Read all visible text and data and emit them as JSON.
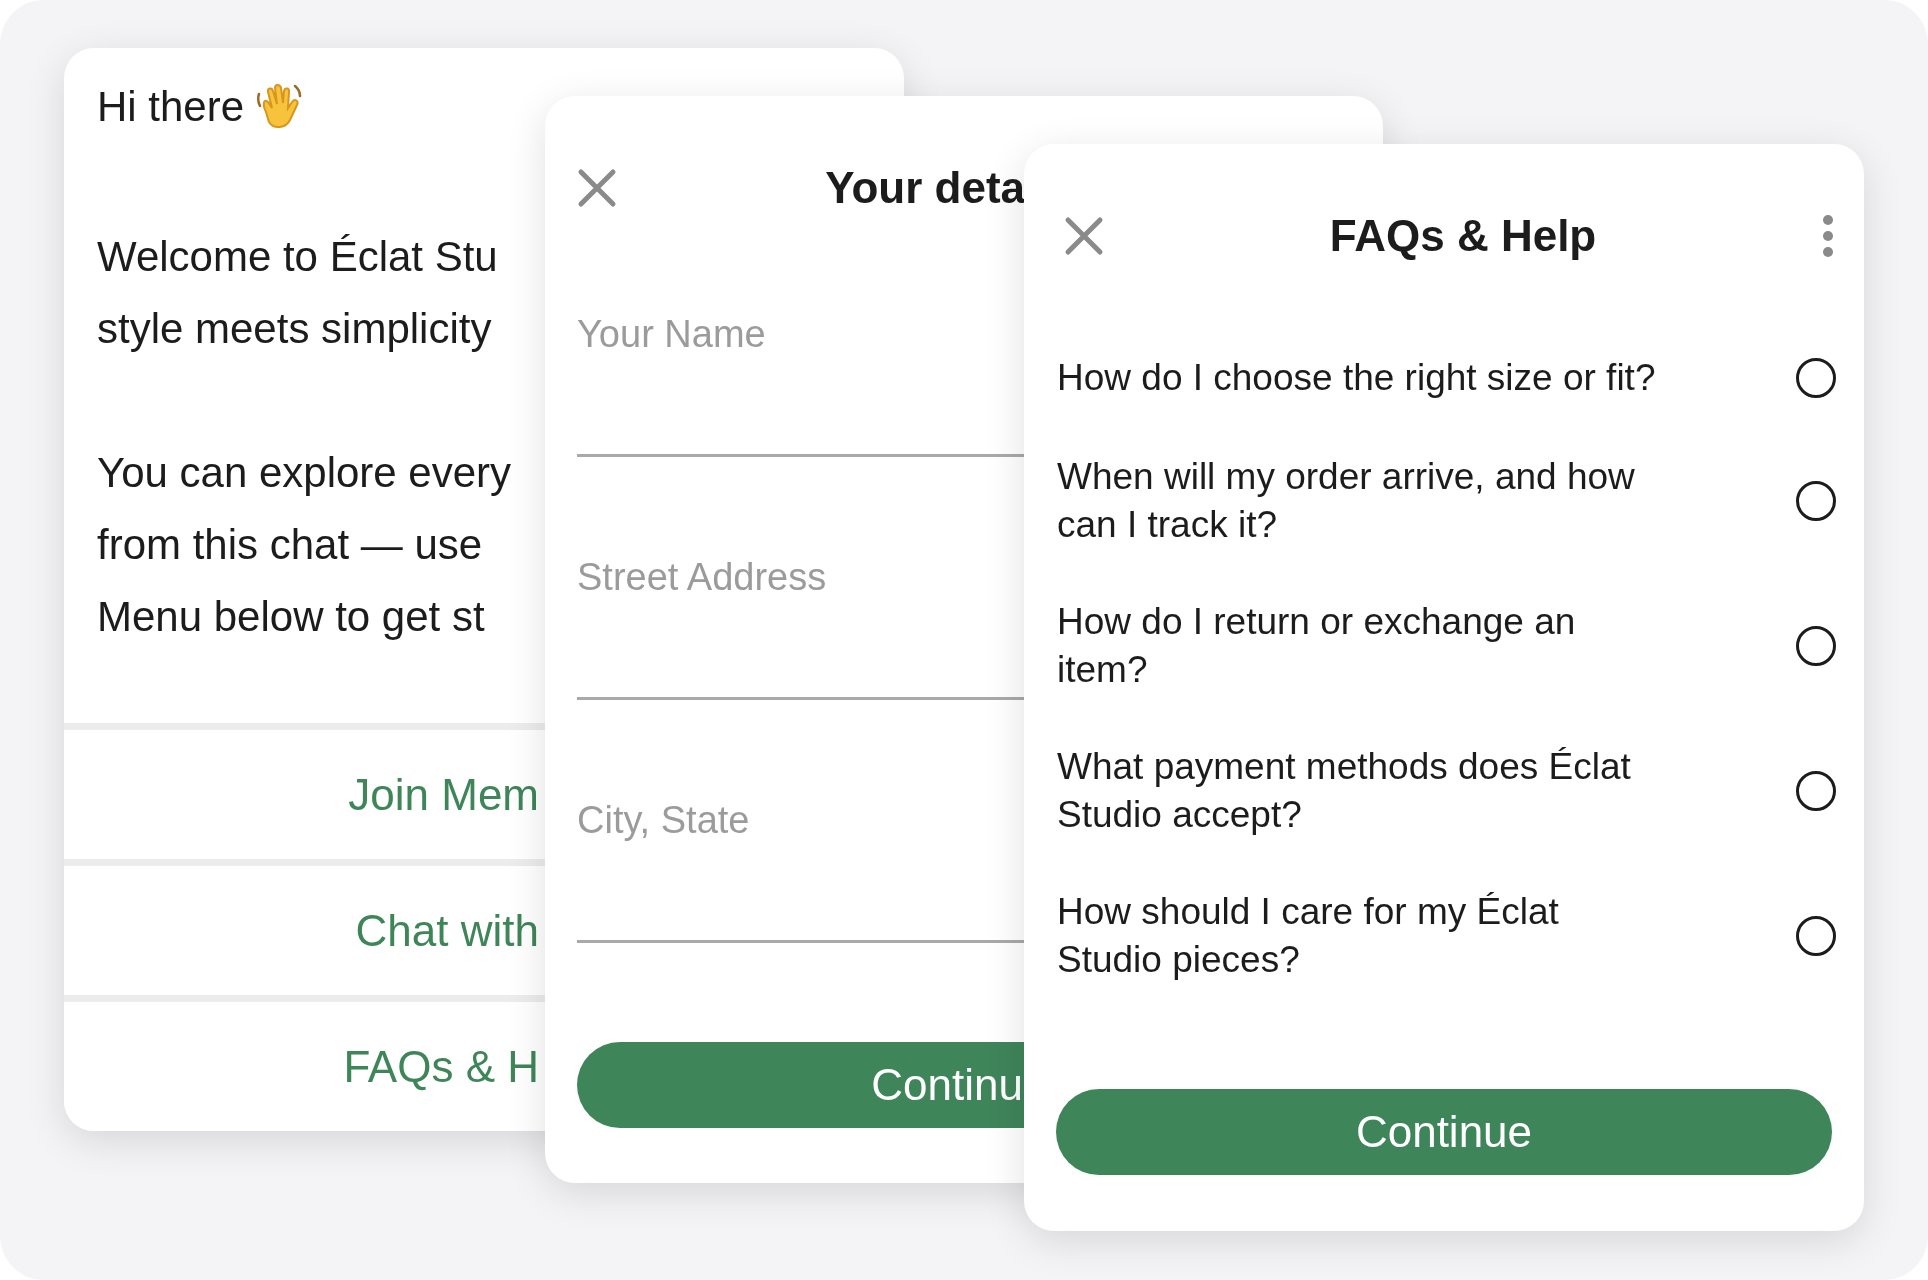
{
  "welcome_card": {
    "greeting": "Hi there",
    "paragraphs": [
      [
        "Welcome to Éclat Stu",
        "style meets simplicity"
      ],
      [
        "You can explore every",
        "from this chat — use",
        "Menu below to get st"
      ]
    ],
    "buttons": [
      "Join Mem",
      "Chat with",
      "FAQs & H"
    ]
  },
  "details_card": {
    "title": "Your deta",
    "fields": [
      {
        "placeholder": "Your Name"
      },
      {
        "placeholder": "Street Address"
      },
      {
        "placeholder": "City, State"
      }
    ],
    "button": "Continu"
  },
  "faq_card": {
    "title": "FAQs & Help",
    "questions": [
      {
        "lines": [
          "How do I choose the right size or fit?"
        ],
        "selected": false
      },
      {
        "lines": [
          "When will my order arrive, and how",
          "can I track it?"
        ],
        "selected": false
      },
      {
        "lines": [
          "How do I return or exchange an",
          "item?"
        ],
        "selected": false
      },
      {
        "lines": [
          "What payment methods does Éclat",
          "Studio accept?"
        ],
        "selected": false
      },
      {
        "lines": [
          "How should I care for my Éclat",
          "Studio pieces?"
        ],
        "selected": false
      }
    ],
    "button": "Continue"
  }
}
